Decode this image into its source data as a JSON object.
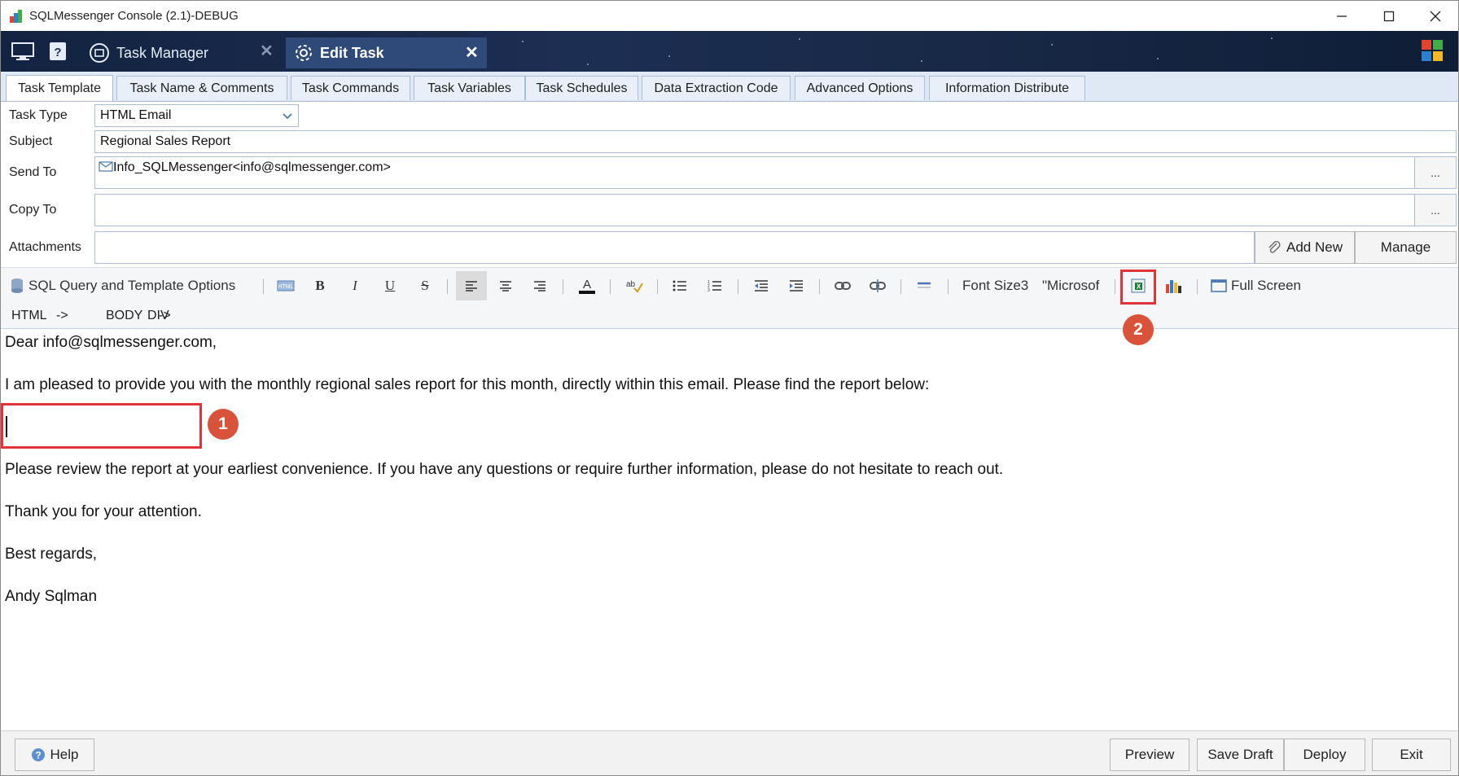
{
  "window": {
    "title": "SQLMessenger Console (2.1)-DEBUG",
    "minimize_icon": "minimize-icon",
    "maximize_icon": "maximize-icon",
    "close_icon": "close-icon"
  },
  "navbar": {
    "tabs": [
      {
        "label": "Task Manager",
        "icon": "task-manager-icon",
        "active": false
      },
      {
        "label": "Edit Task",
        "icon": "gear-icon",
        "active": true
      }
    ]
  },
  "subtabs": [
    "Task Template",
    "Task Name & Comments",
    "Task Commands",
    "Task Variables",
    "Task Schedules",
    "Data Extraction Code",
    "Advanced Options",
    "Information Distribute"
  ],
  "form": {
    "task_type_label": "Task Type",
    "task_type_value": "HTML Email",
    "subject_label": "Subject",
    "subject_value": "Regional Sales Report",
    "send_to_label": "Send To",
    "send_to_value": "Info_SQLMessenger<info@sqlmessenger.com>",
    "copy_to_label": "Copy To",
    "copy_to_value": "",
    "attachments_label": "Attachments",
    "browse_label": "...",
    "add_new_label": "Add New",
    "manage_label": "Manage"
  },
  "toolbar": {
    "sql_options_label": "SQL Query and Template Options",
    "font_size_label": "Font Size3",
    "font_name_label": "\"Microsof",
    "full_screen_label": "Full Screen"
  },
  "path": {
    "items": [
      "HTML",
      "->",
      "BODY",
      "->",
      "DIV"
    ]
  },
  "editor": {
    "paragraphs": [
      "Dear info@sqlmessenger.com,",
      "I am pleased to provide you with the monthly regional sales report for this month, directly within this email. Please find the report below:",
      "Please review the report at your earliest convenience. If you have any questions or require further information, please do not hesitate to reach out.",
      "Thank you for your attention.",
      "Best regards,",
      "Andy Sqlman"
    ]
  },
  "callouts": [
    "1",
    "2"
  ],
  "footer": {
    "help_label": "Help",
    "preview_label": "Preview",
    "save_draft_label": "Save Draft",
    "deploy_label": "Deploy",
    "exit_label": "Exit"
  },
  "colors": {
    "navbar_bg": "#1c2e52",
    "active_tab_bg": "#2f4a78",
    "callout": "#d9533a",
    "highlight_box": "#e0333a",
    "tab_border": "#a9bcd8"
  }
}
